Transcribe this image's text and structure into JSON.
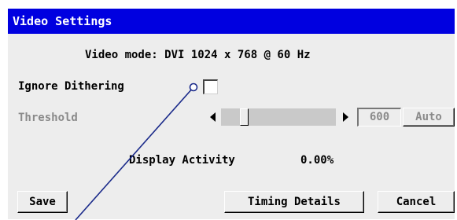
{
  "dialog": {
    "title": "Video Settings",
    "video_mode": "Video mode: DVI 1024 x 768 @ 60 Hz",
    "ignore_dithering_label": "Ignore Dithering",
    "ignore_dithering_checked": false,
    "threshold_label": "Threshold",
    "threshold_value": "600",
    "threshold_slider_fraction": 0.02,
    "auto_label": "Auto",
    "display_activity_label": "Display Activity",
    "display_activity_value": "0.00%",
    "buttons": {
      "save": "Save",
      "timing_details": "Timing Details",
      "cancel": "Cancel"
    }
  },
  "colors": {
    "title_bar": "#0000e0",
    "dialog_background": "#ededed",
    "disabled_text": "#8a8a8a",
    "callout_line": "#1a2a8a"
  }
}
